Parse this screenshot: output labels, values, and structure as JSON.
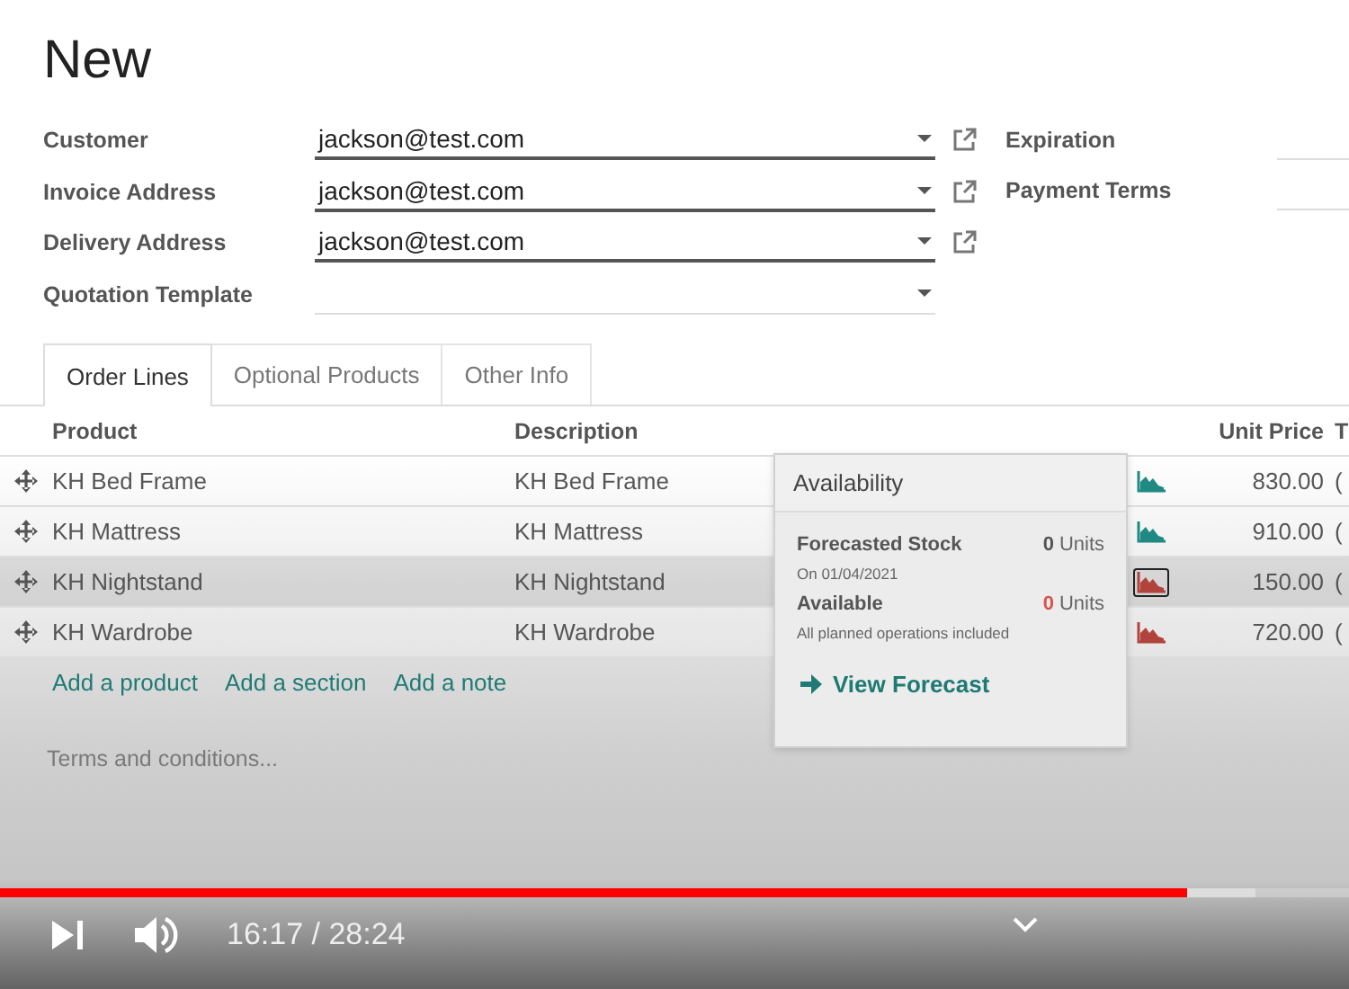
{
  "title": "New",
  "form": {
    "left": [
      {
        "label": "Customer",
        "value": "jackson@test.com",
        "link": true
      },
      {
        "label": "Invoice Address",
        "value": "jackson@test.com",
        "link": true
      },
      {
        "label": "Delivery Address",
        "value": "jackson@test.com",
        "link": true
      },
      {
        "label": "Quotation Template",
        "link": false
      }
    ],
    "right": [
      {
        "label": "Expiration"
      },
      {
        "label": "Payment Terms"
      }
    ]
  },
  "tabs": [
    {
      "label": "Order Lines",
      "selected": true
    },
    {
      "label": "Optional Products",
      "selected": false
    },
    {
      "label": "Other Info",
      "selected": false
    }
  ],
  "table": {
    "columns": [
      "Product",
      "Description",
      "Unit Price",
      "T"
    ],
    "rows": [
      {
        "product": "KH Bed Frame",
        "description": "KH Bed Frame",
        "color": "#1f8a84",
        "highlighted": false,
        "active": false,
        "unit_price": "830.00",
        "column_5": "("
      },
      {
        "product": "KH Mattress",
        "description": "KH Mattress",
        "color": "#1f8a84",
        "highlighted": false,
        "active": false,
        "unit_price": "910.00",
        "column_5": "("
      },
      {
        "product": "KH Nightstand",
        "description": "KH Nightstand",
        "color": "#b0443c",
        "highlighted": true,
        "active": true,
        "unit_price": "150.00",
        "column_5": "("
      },
      {
        "product": "KH Wardrobe",
        "description": "KH Wardrobe",
        "color": "#b0443c",
        "highlighted": false,
        "active": false,
        "unit_price": "720.00",
        "column_5": "("
      }
    ],
    "add_links": [
      "Add a product",
      "Add a section",
      "Add a note"
    ]
  },
  "terms": {
    "placeholder": "Terms and conditions..."
  },
  "popover": {
    "title": "Availability",
    "lines": [
      {
        "label": "Forecasted Stock",
        "qty": "0",
        "unit": "Units",
        "note": "On 01/04/2021",
        "color": "#555555"
      },
      {
        "label": "Available",
        "qty": "0",
        "unit": "Units",
        "note": "All planned operations included",
        "color": "#d9534f"
      }
    ],
    "button": "View Forecast"
  },
  "player": {
    "progress": {
      "level": 0.88
    },
    "buffer": {
      "level": 0.93
    },
    "time": "16:17 / 28:24"
  }
}
